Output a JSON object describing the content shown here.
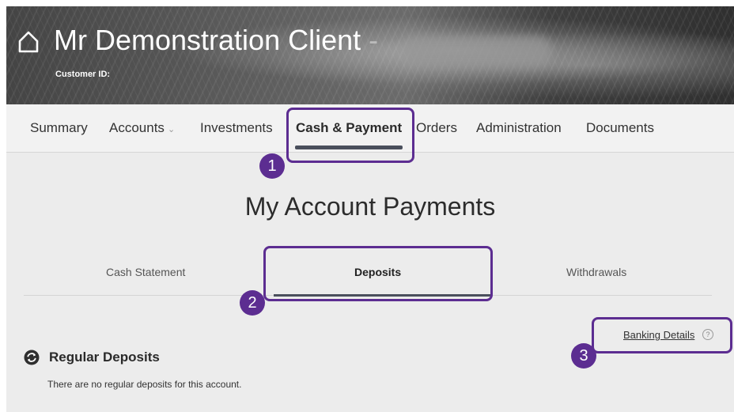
{
  "header": {
    "client_name": "Mr Demonstration Client",
    "separator": "-",
    "customer_id_label": "Customer ID:"
  },
  "nav": {
    "items": [
      {
        "label": "Summary"
      },
      {
        "label": "Accounts",
        "has_dropdown": true
      },
      {
        "label": "Investments"
      },
      {
        "label": "Cash & Payment",
        "active": true
      },
      {
        "label": "Orders"
      },
      {
        "label": "Administration"
      },
      {
        "label": "Documents"
      }
    ]
  },
  "main": {
    "title": "My Account Payments",
    "tabs": [
      {
        "label": "Cash Statement"
      },
      {
        "label": "Deposits",
        "active": true
      },
      {
        "label": "Withdrawals"
      }
    ],
    "banking_details_link": "Banking Details",
    "help_glyph": "?",
    "section": {
      "title": "Regular Deposits",
      "empty_message": "There are no regular deposits for this account."
    }
  },
  "callouts": [
    {
      "number": "1"
    },
    {
      "number": "2"
    },
    {
      "number": "3"
    }
  ],
  "colors": {
    "callout": "#5c2d91",
    "active_underline": "#4a4f5c",
    "background": "#ececec"
  },
  "icons": {
    "home": "home-icon",
    "regular_deposits": "sync-circle-icon",
    "help": "help-circle-icon"
  }
}
